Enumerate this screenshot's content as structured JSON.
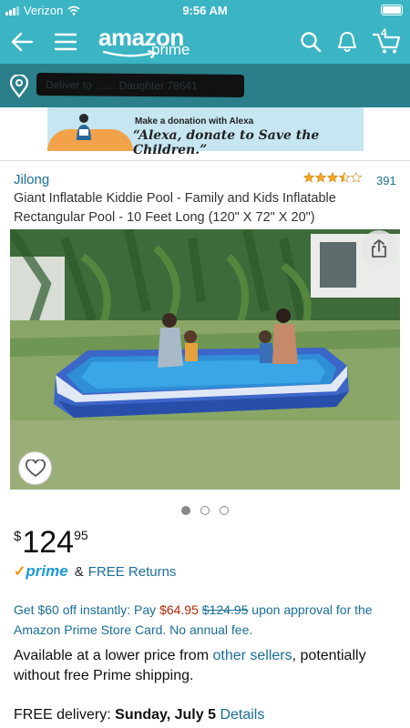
{
  "status": {
    "carrier": "Verizon",
    "time": "9:56 AM"
  },
  "header": {
    "logo_amazon": "amazon",
    "logo_prime": "prime",
    "cart_count": "4"
  },
  "deliver": {
    "text": "Deliver to ....... Daughter 78641"
  },
  "banner": {
    "small_text": "Make a donation with Alexa",
    "big_text": "“Alexa, donate to Save the Children.”"
  },
  "product": {
    "brand": "Jilong",
    "rating": 3.5,
    "rating_count": "391",
    "title": "Giant Inflatable Kiddie Pool - Family and Kids Inflatable Rectangular Pool - 10 Feet Long (120\" X 72\" X 20\")",
    "image_count": 3,
    "active_image": 1
  },
  "price": {
    "currency": "$",
    "whole": "124",
    "fraction": "95"
  },
  "prime_row": {
    "check": "✓",
    "prime": "prime",
    "amp": "&",
    "returns": "FREE Returns"
  },
  "offer": {
    "part1": "Get $60 off instantly: Pay ",
    "sale_price": "$64.95",
    "space": " ",
    "was_price": "$124.95",
    "part2": " upon approval for the Amazon Prime Store Card. No annual fee."
  },
  "availability": {
    "part1": "Available at a lower price from ",
    "link": "other sellers",
    "part2": ", potentially without free Prime shipping."
  },
  "delivery": {
    "label": "FREE delivery: ",
    "date": "Sunday, July 5",
    "details": "Details"
  },
  "colors": {
    "header": "#3bb4c4",
    "deliver_bar": "#2a7f8a",
    "link": "#1a6e98",
    "sale": "#b12704",
    "prime_check": "#f79400"
  }
}
